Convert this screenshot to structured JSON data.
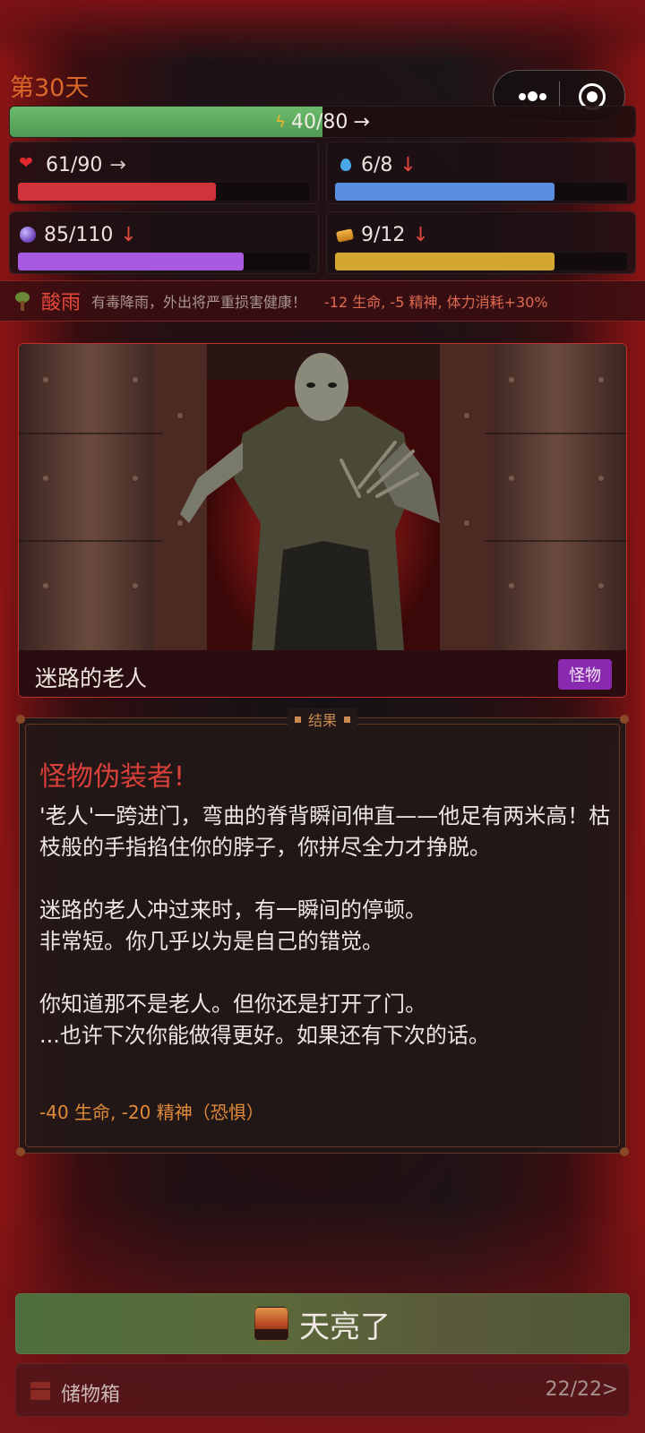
{
  "header": {
    "day": "第30天"
  },
  "energy": {
    "text": "40/80",
    "trend": "→",
    "fraction": 0.5
  },
  "stats": [
    {
      "id": "health",
      "icon": "heart-icon",
      "value": "61/90",
      "trend": "→",
      "trend_type": "flat",
      "fraction": 0.678,
      "color": "#d0343a"
    },
    {
      "id": "water",
      "icon": "water-drop-icon",
      "value": "6/8",
      "trend": "↓",
      "trend_type": "down",
      "fraction": 0.75,
      "color": "#5a8ee0"
    },
    {
      "id": "sanity",
      "icon": "mind-orb-icon",
      "value": "85/110",
      "trend": "↓",
      "trend_type": "down",
      "fraction": 0.773,
      "color": "#a85ae0"
    },
    {
      "id": "food",
      "icon": "food-icon",
      "value": "9/12",
      "trend": "↓",
      "trend_type": "down",
      "fraction": 0.75,
      "color": "#d3a730"
    }
  ],
  "weather": {
    "icon": "dead-tree-icon",
    "name": "酸雨",
    "description": "有毒降雨，外出将严重损害健康！",
    "effect": "-12 生命, -5 精神, 体力消耗+30%"
  },
  "event": {
    "title": "迷路的老人",
    "tag": "怪物"
  },
  "result": {
    "label": "结果",
    "title": "怪物伪装者!",
    "paragraphs": [
      "'老人'一跨进门，弯曲的脊背瞬间伸直——他足有两米高！枯枝般的手指掐住你的脖子，你拼尽全力才挣脱。",
      "迷路的老人冲过来时，有一瞬间的停顿。\n非常短。你几乎以为是自己的错觉。",
      "你知道那不是老人。但你还是打开了门。\n...也许下次你能做得更好。如果还有下次的话。"
    ],
    "effect": "-40 生命, -20 精神（恐惧）"
  },
  "actions": {
    "dawn_label": "天亮了"
  },
  "storage": {
    "label": "储物箱",
    "count": "22/22",
    "chevron": ">"
  }
}
